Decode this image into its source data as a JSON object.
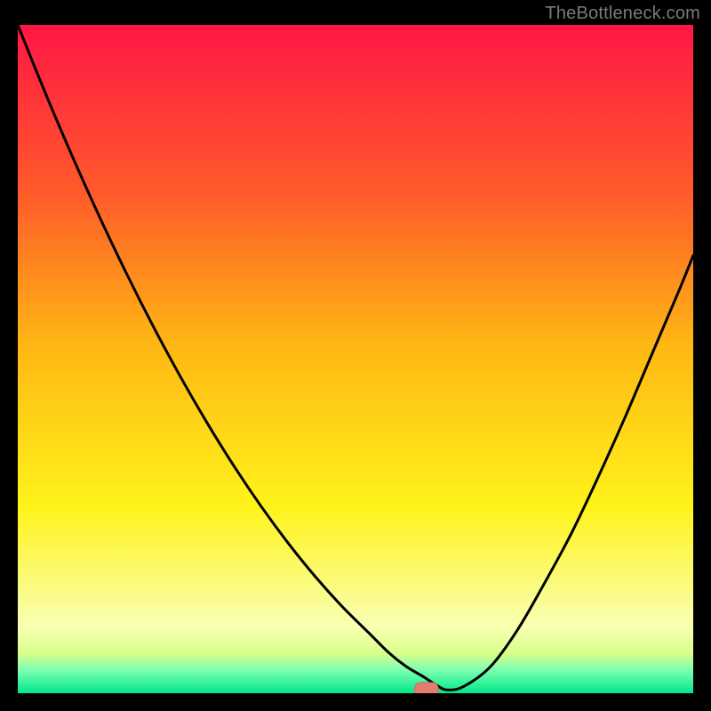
{
  "watermark": {
    "text": "TheBottleneck.com"
  },
  "colors": {
    "black": "#000000",
    "curve": "#000000",
    "marker_fill": "#e27e6f",
    "marker_stroke": "#cf6b5d",
    "gradient_top": "#ff1744",
    "gradient_upper": "#ff5a2a",
    "gradient_mid": "#ffb714",
    "gradient_lower": "#fff31a",
    "gradient_pale": "#f9ffb3",
    "gradient_band_top": "#d9ff8a",
    "gradient_band_mid": "#7fffb0",
    "gradient_bottom": "#00e88c"
  },
  "chart_data": {
    "type": "line",
    "title": "",
    "xlabel": "",
    "ylabel": "",
    "xlim": [
      0,
      100
    ],
    "ylim": [
      0,
      100
    ],
    "x": [
      0,
      4,
      8,
      12,
      16,
      20,
      24,
      28,
      32,
      36,
      40,
      44,
      48,
      52,
      55,
      57.5,
      60,
      62,
      63.5,
      66,
      70,
      74,
      78,
      82,
      86,
      90,
      94,
      98,
      100
    ],
    "values": [
      100,
      90,
      80.5,
      71.5,
      63,
      55,
      47.5,
      40.5,
      34,
      28,
      22.5,
      17.5,
      13,
      9,
      6,
      4,
      2.5,
      1.2,
      0.5,
      1,
      4,
      9.5,
      16.5,
      24,
      32.5,
      41.5,
      51,
      60.5,
      65.5
    ],
    "marker": {
      "x": 60.5,
      "y": 0.5,
      "width": 3.5,
      "height": 2.2
    },
    "notes": "V-shaped bottleneck curve over vertical red→orange→yellow→green gradient background; minimum around x≈60."
  }
}
